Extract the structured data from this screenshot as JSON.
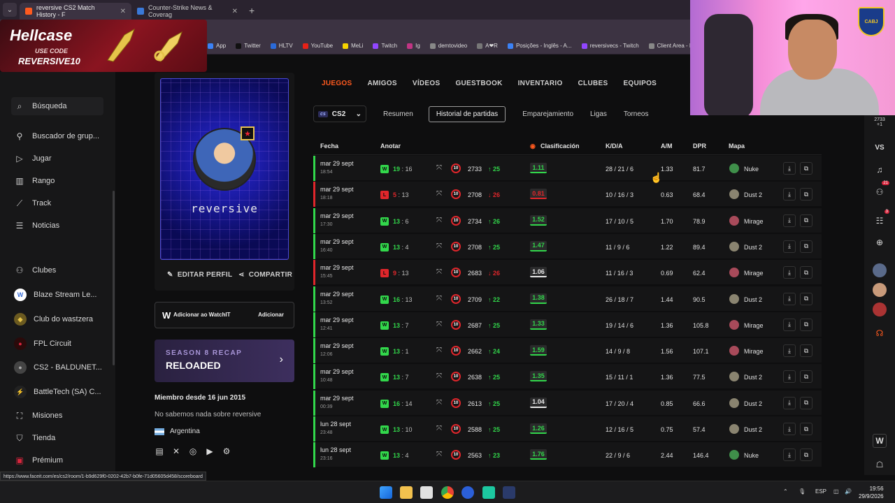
{
  "browser": {
    "tabs": [
      {
        "title": "reversive CS2 Match History - F",
        "active": true,
        "color": "#ff5a1f"
      },
      {
        "title": "Counter-Strike News & Coverag",
        "active": false,
        "color": "#3a79d8"
      }
    ],
    "bookmarks": [
      "App",
      "Twitter",
      "HLTV",
      "YouTube",
      "MeLi",
      "Twitch",
      "Ig",
      "demtovideo",
      "A❤R",
      "Posições - Inglês - A...",
      "reversivecs - Twitch",
      "Client Area - Mejor"
    ],
    "status_url": "https://www.faceit.com/es/cs2/room/1-b9d629f0-0202-42b7-b0fe-71d05605d458/scoreboard"
  },
  "ad": {
    "brand": "Hellcase",
    "use_code": "USE CODE",
    "code": "REVERSIVE10"
  },
  "sidebar": {
    "search": "Búsqueda",
    "items": [
      {
        "label": "Buscador de grup...",
        "icon": "group-search-icon"
      },
      {
        "label": "Jugar",
        "icon": "play-icon"
      },
      {
        "label": "Rango",
        "icon": "ranking-icon"
      },
      {
        "label": "Track",
        "icon": "track-icon"
      },
      {
        "label": "Noticias",
        "icon": "news-icon"
      }
    ],
    "clubs_label": "Clubes",
    "clubs": [
      {
        "label": "Blaze Stream Le...",
        "color": "#3a6fd8",
        "letter": "W"
      },
      {
        "label": "Club do wastzera",
        "color": "#c9a227",
        "letter": "◆"
      },
      {
        "label": "FPL Circuit",
        "color": "#d7263d",
        "letter": "●"
      },
      {
        "label": "CS2 - BALDUNET...",
        "color": "#555",
        "letter": "●"
      },
      {
        "label": "BattleTech (SA) C...",
        "color": "#e2d94a",
        "letter": "⚡"
      }
    ],
    "bottom": [
      {
        "label": "Misiones",
        "icon": "missions-icon"
      },
      {
        "label": "Tienda",
        "icon": "shop-icon"
      },
      {
        "label": "Prémium",
        "icon": "premium-icon"
      }
    ]
  },
  "profile": {
    "nickname": "reversive",
    "level": "★",
    "edit": "EDITAR PERFIL",
    "share": "COMPARTIR",
    "watchit_text": "Adicionar ao WatchIT",
    "watchit_button": "Adicionar",
    "recap_season": "SEASON 8 RECAP",
    "recap_title": "RELOADED",
    "member_since": "Miembro desde 16 jun 2015",
    "about": "No sabemos nada sobre reversive",
    "country": "Argentina"
  },
  "nav": {
    "tabs": [
      "JUEGOS",
      "AMIGOS",
      "VÍDEOS",
      "GUESTBOOK",
      "INVENTARIO",
      "CLUBES",
      "EQUIPOS"
    ],
    "game": "CS2",
    "game_badge": "cs",
    "subtabs": [
      "Resumen",
      "Historial de partidas",
      "Emparejamiento",
      "Ligas",
      "Torneos"
    ]
  },
  "table": {
    "headers": {
      "date": "Fecha",
      "score": "Anotar",
      "rating": "Clasificación",
      "kda": "K/D/A",
      "am": "A/M",
      "dpr": "DPR",
      "map": "Mapa"
    },
    "rows": [
      {
        "date": "mar 29 sept",
        "time": "18:54",
        "result": "W",
        "s1": "19",
        "s2": "16",
        "level": "10",
        "elo": "2733",
        "delta": "↑ 25",
        "rating": "1.11",
        "kda": "28 / 21 / 6",
        "am": "1.33",
        "dpr": "81.7",
        "map": "Nuke"
      },
      {
        "date": "mar 29 sept",
        "time": "18:18",
        "result": "L",
        "s1": "5",
        "s2": "13",
        "level": "10",
        "elo": "2708",
        "delta": "↓ 26",
        "rating": "0.81",
        "kda": "10 / 16 / 3",
        "am": "0.63",
        "dpr": "68.4",
        "map": "Dust 2"
      },
      {
        "date": "mar 29 sept",
        "time": "17:30",
        "result": "W",
        "s1": "13",
        "s2": "6",
        "level": "10",
        "elo": "2734",
        "delta": "↑ 26",
        "rating": "1.52",
        "kda": "17 / 10 / 5",
        "am": "1.70",
        "dpr": "78.9",
        "map": "Mirage"
      },
      {
        "date": "mar 29 sept",
        "time": "16:40",
        "result": "W",
        "s1": "13",
        "s2": "4",
        "level": "10",
        "elo": "2708",
        "delta": "↑ 25",
        "rating": "1.47",
        "kda": "11 / 9 / 6",
        "am": "1.22",
        "dpr": "89.4",
        "map": "Dust 2"
      },
      {
        "date": "mar 29 sept",
        "time": "15:45",
        "result": "L",
        "s1": "9",
        "s2": "13",
        "level": "10",
        "elo": "2683",
        "delta": "↓ 26",
        "rating": "1.06",
        "kda": "11 / 16 / 3",
        "am": "0.69",
        "dpr": "62.4",
        "map": "Mirage"
      },
      {
        "date": "mar 29 sept",
        "time": "13:52",
        "result": "W",
        "s1": "16",
        "s2": "13",
        "level": "10",
        "elo": "2709",
        "delta": "↑ 22",
        "rating": "1.38",
        "kda": "26 / 18 / 7",
        "am": "1.44",
        "dpr": "90.5",
        "map": "Dust 2"
      },
      {
        "date": "mar 29 sept",
        "time": "12:41",
        "result": "W",
        "s1": "13",
        "s2": "7",
        "level": "10",
        "elo": "2687",
        "delta": "↑ 25",
        "rating": "1.33",
        "kda": "19 / 14 / 6",
        "am": "1.36",
        "dpr": "105.8",
        "map": "Mirage"
      },
      {
        "date": "mar 29 sept",
        "time": "12:06",
        "result": "W",
        "s1": "13",
        "s2": "1",
        "level": "10",
        "elo": "2662",
        "delta": "↑ 24",
        "rating": "1.59",
        "kda": "14 / 9 / 8",
        "am": "1.56",
        "dpr": "107.1",
        "map": "Mirage"
      },
      {
        "date": "mar 29 sept",
        "time": "10:48",
        "result": "W",
        "s1": "13",
        "s2": "7",
        "level": "10",
        "elo": "2638",
        "delta": "↑ 25",
        "rating": "1.35",
        "kda": "15 / 11 / 1",
        "am": "1.36",
        "dpr": "77.5",
        "map": "Dust 2"
      },
      {
        "date": "mar 29 sept",
        "time": "00:39",
        "result": "W",
        "s1": "16",
        "s2": "14",
        "level": "10",
        "elo": "2613",
        "delta": "↑ 25",
        "rating": "1.04",
        "kda": "17 / 20 / 4",
        "am": "0.85",
        "dpr": "66.6",
        "map": "Dust 2"
      },
      {
        "date": "lun 28 sept",
        "time": "23:48",
        "result": "W",
        "s1": "13",
        "s2": "10",
        "level": "10",
        "elo": "2588",
        "delta": "↑ 25",
        "rating": "1.26",
        "kda": "12 / 16 / 5",
        "am": "0.75",
        "dpr": "57.4",
        "map": "Dust 2"
      },
      {
        "date": "lun 28 sept",
        "time": "23:16",
        "result": "W",
        "s1": "13",
        "s2": "4",
        "level": "10",
        "elo": "2563",
        "delta": "↑ 23",
        "rating": "1.76",
        "kda": "22 / 9 / 6",
        "am": "2.44",
        "dpr": "146.4",
        "map": "Nuke"
      }
    ]
  },
  "right_rail": {
    "elo_small": "2733",
    "elo_delta": "+1",
    "vs": "VS",
    "friends_badge": "21",
    "party_badge": "3"
  },
  "colors": {
    "accent": "#ff5a1f",
    "win": "#32d74b",
    "loss": "#e0262b",
    "bg": "#0e0e0f"
  },
  "taskbar": {
    "lang": "ESP",
    "time": "19:56",
    "date": "29/9/2026"
  }
}
